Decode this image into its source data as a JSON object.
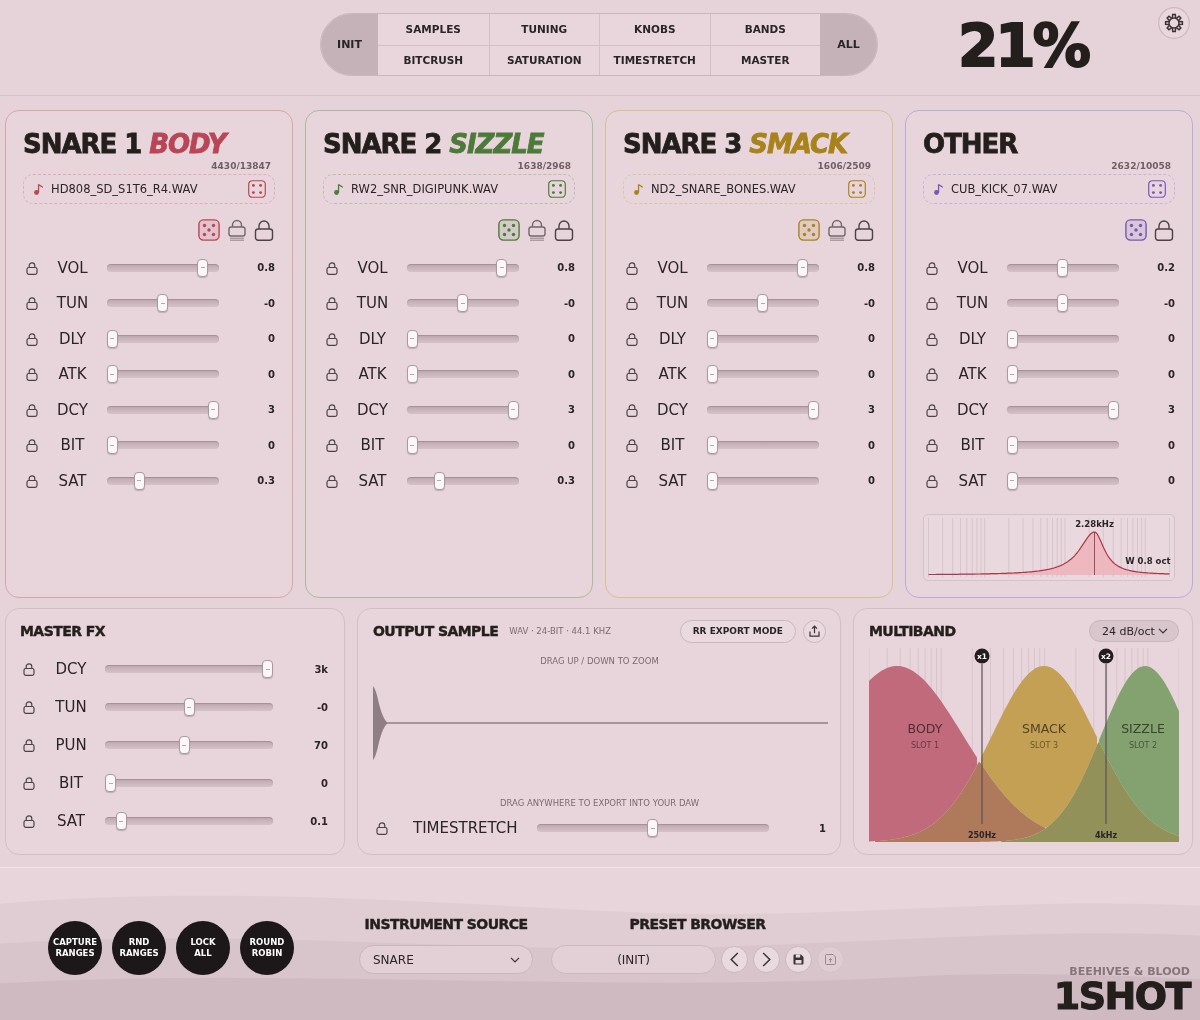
{
  "header": {
    "start": "INIT",
    "groups": [
      "SAMPLES",
      "TUNING",
      "KNOBS",
      "BANDS",
      "BITCRUSH",
      "SATURATION",
      "TIMESTRETCH",
      "MASTER"
    ],
    "end": "ALL",
    "percent": "21%"
  },
  "slots": [
    {
      "name": "SNARE 1",
      "accent": "BODY",
      "color": "#b84656",
      "count": "4430/13847",
      "sample": "HD808_SD_S1T6_R4.WAV",
      "stack_lock": true,
      "params": [
        {
          "label": "VOL",
          "level": 0.9,
          "value": "0.8"
        },
        {
          "label": "TUN",
          "level": 0.5,
          "value": "-0"
        },
        {
          "label": "DLY",
          "level": 0,
          "value": "0"
        },
        {
          "label": "ATK",
          "level": 0,
          "value": "0"
        },
        {
          "label": "DCY",
          "level": 1,
          "value": "3"
        },
        {
          "label": "BIT",
          "level": 0,
          "value": "0"
        },
        {
          "label": "SAT",
          "level": 0.27,
          "value": "0.3"
        }
      ]
    },
    {
      "name": "SNARE 2",
      "accent": "SIZZLE",
      "color": "#4d7a3a",
      "count": "1638/2968",
      "sample": "RW2_SNR_DIGIPUNK.WAV",
      "stack_lock": true,
      "params": [
        {
          "label": "VOL",
          "level": 0.89,
          "value": "0.8"
        },
        {
          "label": "TUN",
          "level": 0.5,
          "value": "-0"
        },
        {
          "label": "DLY",
          "level": 0,
          "value": "0"
        },
        {
          "label": "ATK",
          "level": 0,
          "value": "0"
        },
        {
          "label": "DCY",
          "level": 1,
          "value": "3"
        },
        {
          "label": "BIT",
          "level": 0,
          "value": "0"
        },
        {
          "label": "SAT",
          "level": 0.27,
          "value": "0.3"
        }
      ]
    },
    {
      "name": "SNARE 3",
      "accent": "SMACK",
      "color": "#a8831c",
      "count": "1606/2509",
      "sample": "ND2_SNARE_BONES.WAV",
      "stack_lock": true,
      "params": [
        {
          "label": "VOL",
          "level": 0.9,
          "value": "0.8"
        },
        {
          "label": "TUN",
          "level": 0.5,
          "value": "-0"
        },
        {
          "label": "DLY",
          "level": 0,
          "value": "0"
        },
        {
          "label": "ATK",
          "level": 0,
          "value": "0"
        },
        {
          "label": "DCY",
          "level": 1,
          "value": "3"
        },
        {
          "label": "BIT",
          "level": 0,
          "value": "0"
        },
        {
          "label": "SAT",
          "level": 0,
          "value": "0"
        }
      ]
    },
    {
      "name": "OTHER",
      "color": "#7757b5",
      "count": "2632/10058",
      "sample": "CUB_KICK_07.WAV",
      "stack_lock": false,
      "params": [
        {
          "label": "VOL",
          "level": 0.5,
          "value": "0.2"
        },
        {
          "label": "TUN",
          "level": 0.5,
          "value": "-0"
        },
        {
          "label": "DLY",
          "level": 0,
          "value": "0"
        },
        {
          "label": "ATK",
          "level": 0,
          "value": "0"
        },
        {
          "label": "DCY",
          "level": 1,
          "value": "3"
        },
        {
          "label": "BIT",
          "level": 0,
          "value": "0"
        },
        {
          "label": "SAT",
          "level": 0,
          "value": "0"
        }
      ],
      "filter": {
        "peak_label": "2.28kHz",
        "width_label": "W 0.8 oct"
      }
    }
  ],
  "master_fx": {
    "title": "MASTER FX",
    "params": [
      {
        "label": "DCY",
        "level": 1,
        "value": "3k"
      },
      {
        "label": "TUN",
        "level": 0.5,
        "value": "-0"
      },
      {
        "label": "PUN",
        "level": 0.47,
        "value": "70"
      },
      {
        "label": "BIT",
        "level": 0,
        "value": "0"
      },
      {
        "label": "SAT",
        "level": 0.07,
        "value": "0.1"
      }
    ]
  },
  "output": {
    "title": "OUTPUT SAMPLE",
    "format": "WAV · 24-BIT · 44.1 KHZ",
    "mode_button": "RR EXPORT MODE",
    "zoom_hint": "DRAG UP / DOWN TO ZOOM",
    "export_hint": "DRAG ANYWHERE TO EXPORT INTO YOUR DAW",
    "timestretch": {
      "label": "TIMESTRETCH",
      "level": 0.5,
      "value": "1"
    }
  },
  "multiband": {
    "title": "MULTIBAND",
    "slope": "24 dB/oct",
    "bands": [
      {
        "name": "BODY",
        "slot": "SLOT 1",
        "color": "#c06a7c"
      },
      {
        "name": "SMACK",
        "slot": "SLOT 3",
        "color": "#c4a055"
      },
      {
        "name": "SIZZLE",
        "slot": "SLOT 2",
        "color": "#84a26f"
      }
    ],
    "crossovers": [
      {
        "marker": "x1",
        "freq": "250Hz"
      },
      {
        "marker": "x2",
        "freq": "4kHz"
      }
    ]
  },
  "actions": [
    "CAPTURE RANGES",
    "RND RANGES",
    "LOCK ALL",
    "ROUND ROBIN"
  ],
  "instrument_source": {
    "title": "INSTRUMENT SOURCE",
    "value": "SNARE"
  },
  "preset_browser": {
    "title": "PRESET BROWSER",
    "value": "(INIT)",
    "buttons": [
      {
        "kind": "prev",
        "disabled": false
      },
      {
        "kind": "next",
        "disabled": false
      },
      {
        "kind": "save",
        "disabled": false
      },
      {
        "kind": "save_as",
        "disabled": true
      }
    ]
  },
  "brand": {
    "maker": "BEEHIVES & BLOOD",
    "product": "1SHOT"
  }
}
